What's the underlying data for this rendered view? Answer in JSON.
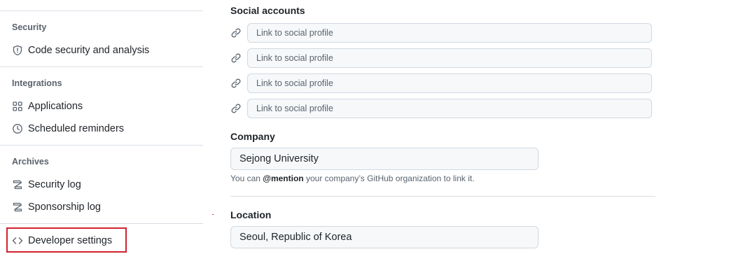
{
  "sidebar": {
    "security_heading": "Security",
    "security_items": [
      {
        "label": "Code security and analysis",
        "icon": "shield-icon"
      }
    ],
    "integrations_heading": "Integrations",
    "integrations_items": [
      {
        "label": "Applications",
        "icon": "apps-grid-icon"
      },
      {
        "label": "Scheduled reminders",
        "icon": "clock-icon"
      }
    ],
    "archives_heading": "Archives",
    "archives_items": [
      {
        "label": "Security log",
        "icon": "log-icon"
      },
      {
        "label": "Sponsorship log",
        "icon": "log-icon"
      }
    ],
    "developer_settings_label": "Developer settings",
    "developer_settings_icon": "code-icon",
    "highlight_color": "#d1242f"
  },
  "profile": {
    "social_accounts_label": "Social accounts",
    "social_links": [
      {
        "value": "",
        "placeholder": "Link to social profile"
      },
      {
        "value": "",
        "placeholder": "Link to social profile"
      },
      {
        "value": "",
        "placeholder": "Link to social profile"
      },
      {
        "value": "",
        "placeholder": "Link to social profile"
      }
    ],
    "company_label": "Company",
    "company_value": "Sejong University",
    "company_hint_prefix": "You can ",
    "company_hint_mention": "@mention",
    "company_hint_suffix": " your company’s GitHub organization to link it.",
    "location_label": "Location",
    "location_value": "Seoul, Republic of Korea"
  }
}
